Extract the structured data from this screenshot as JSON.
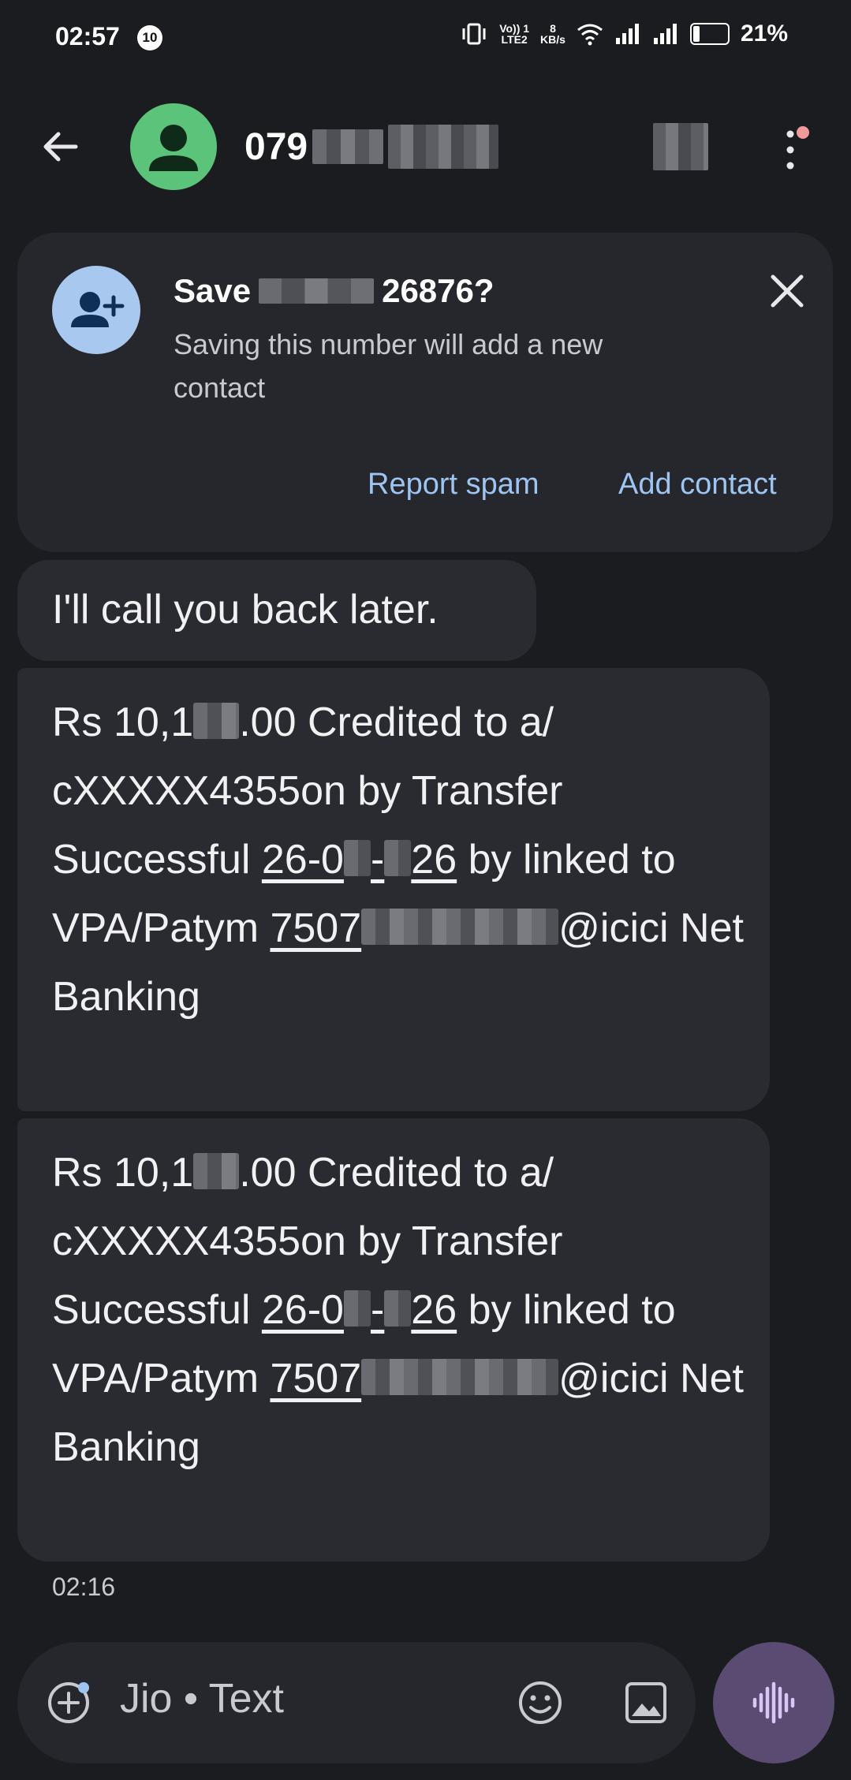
{
  "status_bar": {
    "time": "02:57",
    "badge": "10",
    "net_top": "Vo)) 1",
    "net_bottom": "LTE2",
    "speed_top": "8",
    "speed_bottom": "KB/s",
    "battery": "21%"
  },
  "header": {
    "title_visible": "079",
    "back_icon": "arrow-left-icon",
    "avatar_icon": "person-icon",
    "more_icon": "more-vert-icon"
  },
  "save_card": {
    "title_prefix": "Save",
    "title_suffix": "26876?",
    "subtitle": "Saving this number will add a new contact",
    "report_spam": "Report spam",
    "add_contact": "Add contact",
    "icon": "add-person-icon",
    "close_icon": "close-icon"
  },
  "messages": {
    "quick_reply": "I'll call you back later.",
    "m1": {
      "p1": "Rs 10,1",
      "p2": ".00 Credited to a/ cXXXXX4355on by Transfer Successful ",
      "date_a": "26-0",
      "date_b": "-",
      "date_c": "26",
      "p3": " by linked to VPA/Patym ",
      "vpa_a": "7507",
      "p4": "@icici Net Banking"
    },
    "m2": {
      "p1": "Rs 10,1",
      "p2": ".00 Credited to a/ cXXXXX4355on by Transfer Successful ",
      "date_a": "26-0",
      "date_b": "-",
      "date_c": "26",
      "p3": " by linked to VPA/Patym ",
      "vpa_a": "7507",
      "p4": "@icici Net Banking"
    },
    "timestamp": "02:16"
  },
  "compose": {
    "placeholder": "Jio • Text",
    "plus_icon": "add-circle-icon",
    "emoji_icon": "emoji-icon",
    "gallery_icon": "gallery-icon",
    "voice_icon": "voice-waveform-icon"
  }
}
